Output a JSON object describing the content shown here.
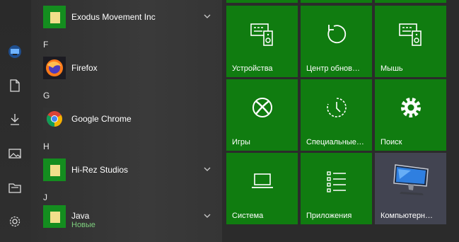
{
  "sections": [
    {
      "letter": "F"
    },
    {
      "letter": "G"
    },
    {
      "letter": "H"
    },
    {
      "letter": "J"
    }
  ],
  "apps": [
    {
      "name": "Exodus Movement Inc",
      "icon": "folder-icon"
    },
    {
      "name": "Firefox",
      "icon": "firefox-icon"
    },
    {
      "name": "Google Chrome",
      "icon": "chrome-icon"
    },
    {
      "name": "Hi-Rez Studios",
      "icon": "folder-icon"
    },
    {
      "name": "Java",
      "icon": "folder-icon",
      "badge": "Новые"
    }
  ],
  "tiles": [
    {
      "label": "Устройства",
      "icon": "devices-icon"
    },
    {
      "label": "Центр обнов…",
      "icon": "update-icon"
    },
    {
      "label": "Мышь",
      "icon": "mouse-icon"
    },
    {
      "label": "Игры",
      "icon": "xbox-icon"
    },
    {
      "label": "Специальные…",
      "icon": "accessibility-icon"
    },
    {
      "label": "Поиск",
      "icon": "gear-icon"
    },
    {
      "label": "Система",
      "icon": "laptop-icon"
    },
    {
      "label": "Приложения",
      "icon": "apps-list-icon"
    },
    {
      "label": "Компьютерн…",
      "icon": "computer-icon"
    }
  ],
  "colors": {
    "tile": "#107c10",
    "folder": "#148d1f",
    "new_badge": "#7ed07e"
  }
}
